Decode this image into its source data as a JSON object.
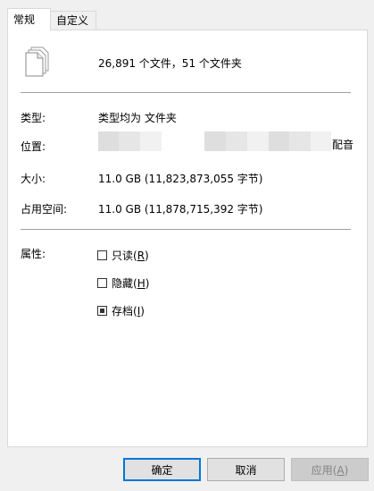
{
  "tabs": [
    {
      "label": "常规",
      "active": true
    },
    {
      "label": "自定义",
      "active": false
    }
  ],
  "summary": {
    "text": "26,891 个文件，51 个文件夹",
    "icon": "multiple-files-icon"
  },
  "properties": {
    "type_label": "类型:",
    "type_value": "类型均为 文件夹",
    "location_label": "位置:",
    "location_tail": "配音",
    "size_label": "大小:",
    "size_value": "11.0 GB (11,823,873,055 字节)",
    "size_on_disk_label": "占用空间:",
    "size_on_disk_value": "11.0 GB (11,878,715,392 字节)"
  },
  "attributes": {
    "label": "属性:",
    "items": [
      {
        "text": "只读(",
        "key": "R",
        "close": ")",
        "checked": false
      },
      {
        "text": "隐藏(",
        "key": "H",
        "close": ")",
        "checked": false
      },
      {
        "text": "存档(",
        "key": "I",
        "close": ")",
        "checked": true,
        "indeterminate": true
      }
    ]
  },
  "buttons": {
    "ok": "确定",
    "cancel": "取消",
    "apply_text": "应用(",
    "apply_key": "A",
    "apply_close": ")"
  },
  "colors": {
    "accent": "#0078d7",
    "panel": "#ffffff",
    "window": "#f0f0f0"
  }
}
